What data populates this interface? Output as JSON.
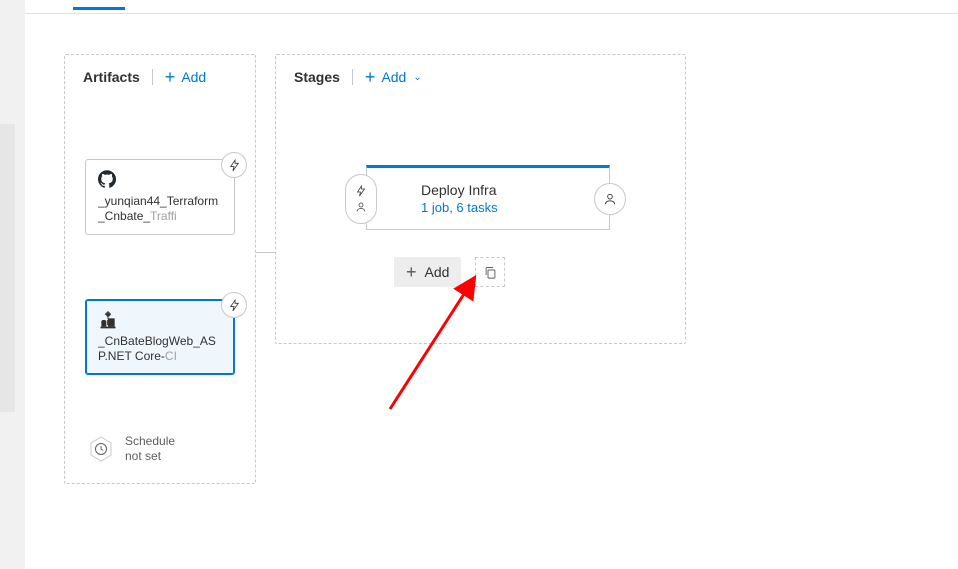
{
  "artifacts": {
    "header_label": "Artifacts",
    "add_label": "Add",
    "items": [
      {
        "name_a": "_yunqian44_Terraform_Cnbate_",
        "name_b": "Traffi",
        "source": "github"
      },
      {
        "name_a": "_CnBateBlogWeb_ASP.NET Core-",
        "name_b": "CI",
        "source": "build"
      }
    ],
    "schedule": {
      "line1": "Schedule",
      "line2": "not set"
    }
  },
  "stages": {
    "header_label": "Stages",
    "add_label": "Add",
    "cards": [
      {
        "title": "Deploy Infra",
        "subtitle": "1 job, 6 tasks"
      }
    ],
    "add_stage_label": "Add"
  }
}
